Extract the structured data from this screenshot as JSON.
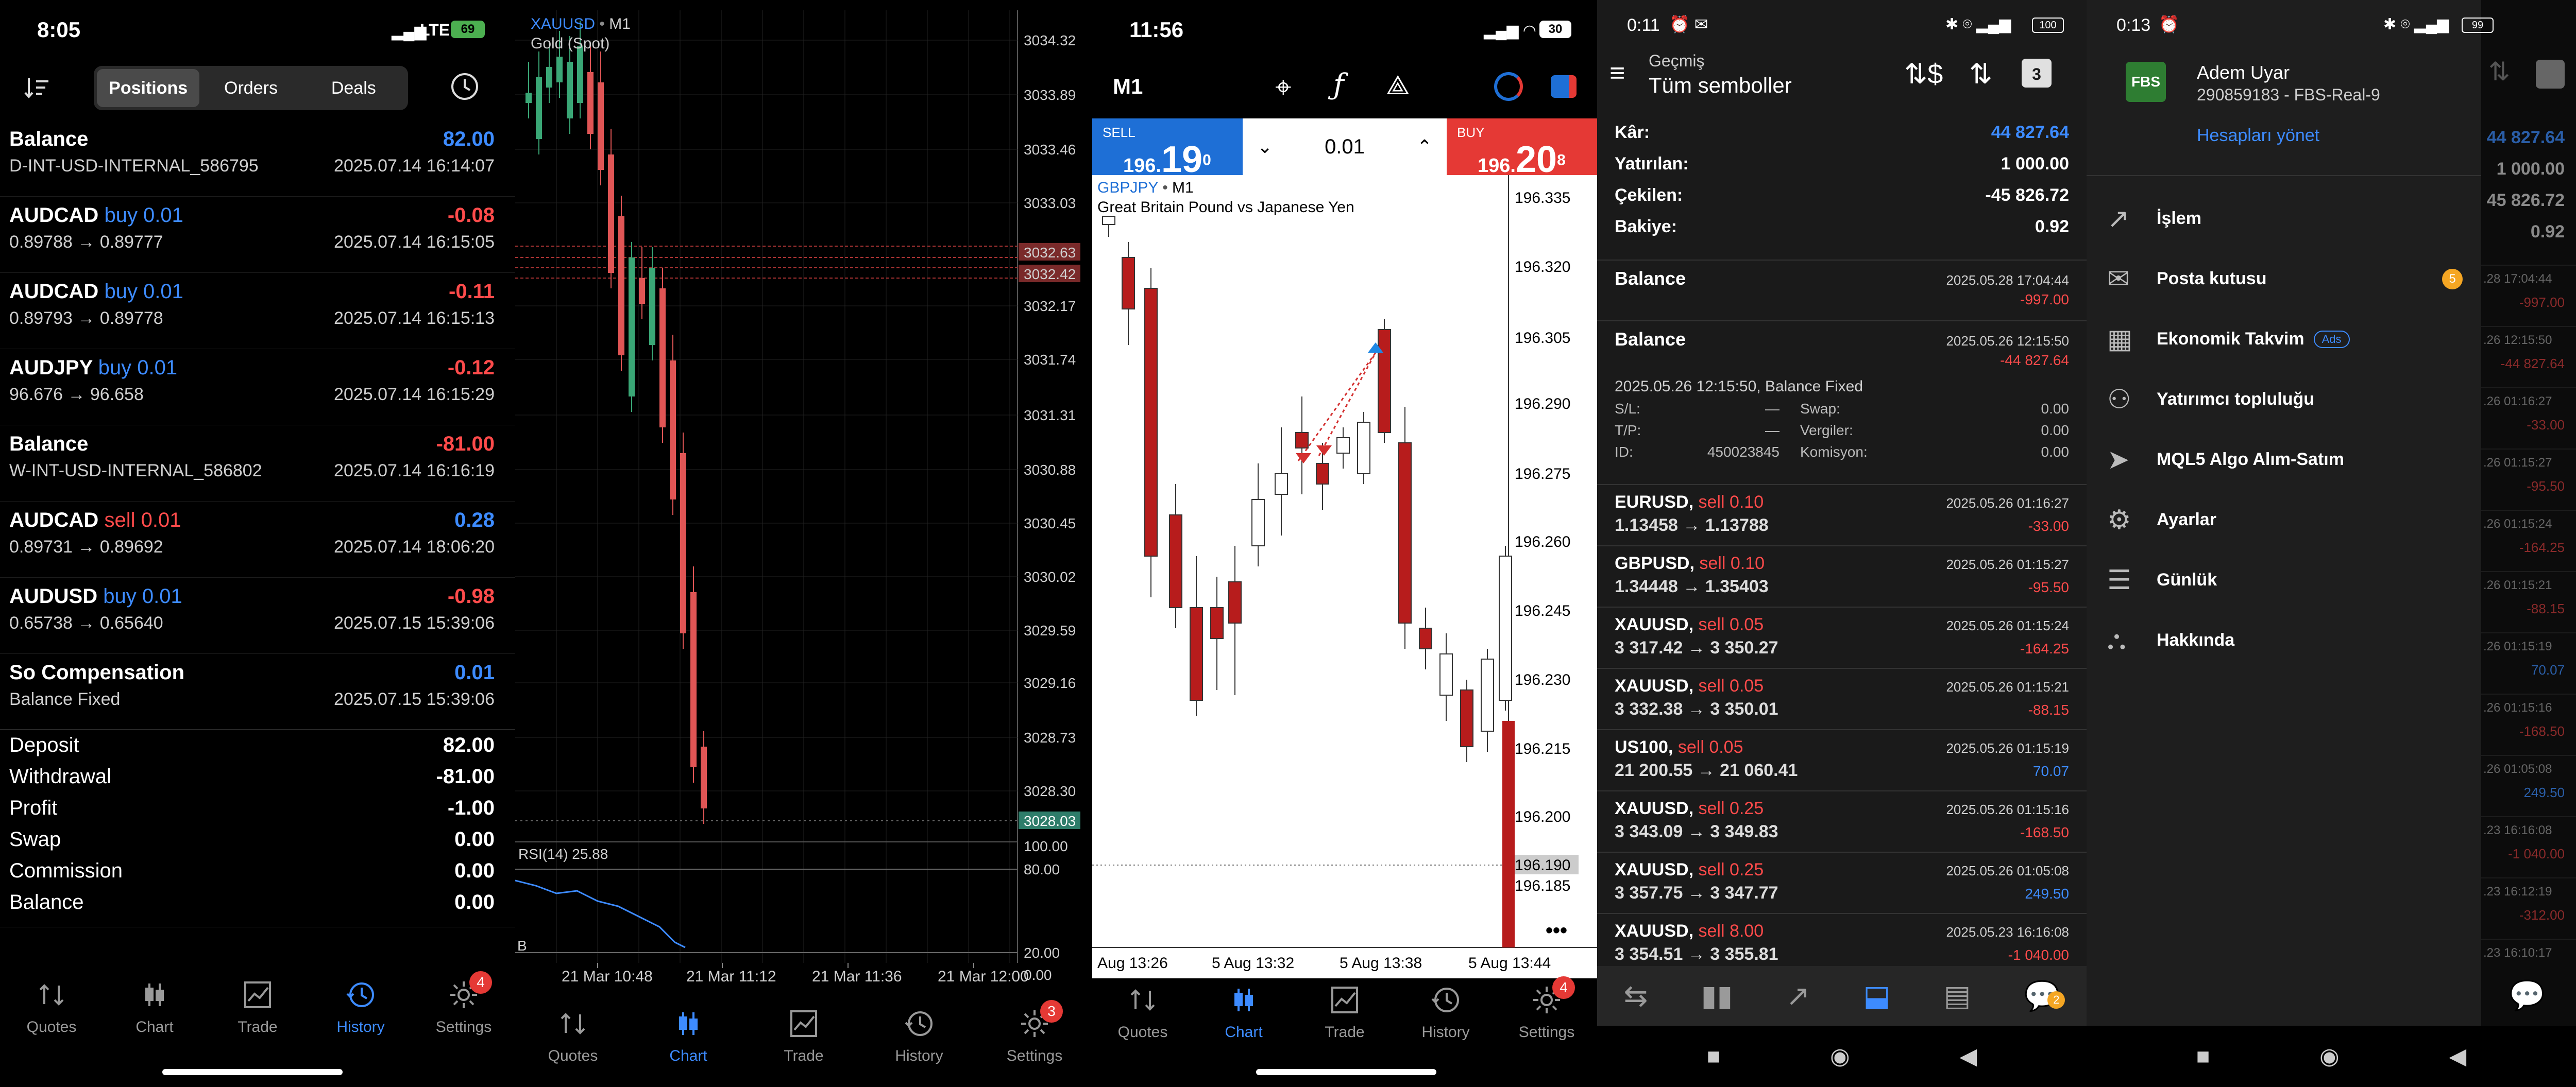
{
  "panel1": {
    "time": "8:05",
    "network": "LTE",
    "battery": "69",
    "segments": [
      "Positions",
      "Orders",
      "Deals"
    ],
    "active_segment": 0,
    "rows": [
      {
        "symbol": "Balance",
        "side": "",
        "value": "82.00",
        "value_color": "blue",
        "sub": "D-INT-USD-INTERNAL_586795",
        "time": "2025.07.14 16:14:07"
      },
      {
        "symbol": "AUDCAD",
        "side": "buy 0.01",
        "side_color": "blue",
        "value": "-0.08",
        "value_color": "red",
        "sub": "0.89788 → 0.89777",
        "time": "2025.07.14 16:15:05"
      },
      {
        "symbol": "AUDCAD",
        "side": "buy 0.01",
        "side_color": "blue",
        "value": "-0.11",
        "value_color": "red",
        "sub": "0.89793 → 0.89778",
        "time": "2025.07.14 16:15:13"
      },
      {
        "symbol": "AUDJPY",
        "side": "buy 0.01",
        "side_color": "blue",
        "value": "-0.12",
        "value_color": "red",
        "sub": "96.676 → 96.658",
        "time": "2025.07.14 16:15:29"
      },
      {
        "symbol": "Balance",
        "side": "",
        "value": "-81.00",
        "value_color": "red",
        "sub": "W-INT-USD-INTERNAL_586802",
        "time": "2025.07.14 16:16:19"
      },
      {
        "symbol": "AUDCAD",
        "side": "sell 0.01",
        "side_color": "red",
        "value": "0.28",
        "value_color": "blue",
        "sub": "0.89731 → 0.89692",
        "time": "2025.07.14 18:06:20"
      },
      {
        "symbol": "AUDUSD",
        "side": "buy 0.01",
        "side_color": "blue",
        "value": "-0.98",
        "value_color": "red",
        "sub": "0.65738 → 0.65640",
        "time": "2025.07.15 15:39:06"
      },
      {
        "symbol": "So Compensation",
        "side": "",
        "value": "0.01",
        "value_color": "blue",
        "sub": "Balance Fixed",
        "time": "2025.07.15 15:39:06"
      }
    ],
    "summary": [
      {
        "label": "Deposit",
        "value": "82.00"
      },
      {
        "label": "Withdrawal",
        "value": "-81.00"
      },
      {
        "label": "Profit",
        "value": "-1.00"
      },
      {
        "label": "Swap",
        "value": "0.00"
      },
      {
        "label": "Commission",
        "value": "0.00"
      },
      {
        "label": "Balance",
        "value": "0.00"
      }
    ],
    "tabs": [
      "Quotes",
      "Chart",
      "Trade",
      "History",
      "Settings"
    ],
    "active_tab": 3,
    "settings_badge": "4"
  },
  "panel2": {
    "symbol": "XAUUSD",
    "timeframe": "M1",
    "subtitle": "Gold (Spot)",
    "price_labels": [
      "3034.32",
      "3033.89",
      "3033.46",
      "3033.03",
      "3032.63",
      "3032.42",
      "3032.17",
      "3031.74",
      "3031.31",
      "3030.88",
      "3030.45",
      "3030.02",
      "3029.59",
      "3029.16",
      "3028.73",
      "3028.30",
      "3028.03"
    ],
    "rsi_label": "RSI(14) 25.88",
    "rsi_levels": [
      "100.00",
      "80.00",
      "20.00",
      "0.00"
    ],
    "rsi_b": "B",
    "time_labels": [
      "21 Mar 10:48",
      "21 Mar 11:12",
      "21 Mar 11:36",
      "21 Mar 12:00"
    ],
    "tabs": [
      "Quotes",
      "Chart",
      "Trade",
      "History",
      "Settings"
    ],
    "active_tab": 1,
    "settings_badge": "3"
  },
  "panel3": {
    "time": "11:56",
    "battery": "30",
    "timeframe": "M1",
    "sell_label": "SELL",
    "sell_price_small": "196.",
    "sell_price_big": "19",
    "sell_price_sup": "0",
    "buy_label": "BUY",
    "buy_price_small": "196.",
    "buy_price_big": "20",
    "buy_price_sup": "8",
    "volume": "0.01",
    "symbol": "GBPJPY",
    "symbol_tf": "M1",
    "subtitle": "Great Britain Pound vs Japanese Yen",
    "price_labels": [
      "196.335",
      "196.320",
      "196.305",
      "196.290",
      "196.275",
      "196.260",
      "196.245",
      "196.230",
      "196.215",
      "196.200",
      "196.190",
      "196.185"
    ],
    "time_labels": [
      "Aug 13:26",
      "5 Aug 13:32",
      "5 Aug 13:38",
      "5 Aug 13:44"
    ],
    "more": "•••",
    "tabs": [
      "Quotes",
      "Chart",
      "Trade",
      "History",
      "Settings"
    ],
    "active_tab": 1,
    "settings_badge": "4"
  },
  "panel4": {
    "time": "0:11",
    "battery": "100",
    "header_small": "Geçmiş",
    "header_title": "Tüm semboller",
    "calendar_num": "3",
    "summary": [
      {
        "label": "Kâr:",
        "value": "44 827.64",
        "color": "blue"
      },
      {
        "label": "Yatırılan:",
        "value": "1 000.00",
        "color": ""
      },
      {
        "label": "Çekilen:",
        "value": "-45 826.72",
        "color": ""
      },
      {
        "label": "Bakiye:",
        "value": "0.92",
        "color": ""
      }
    ],
    "balance1": {
      "title": "Balance",
      "time": "2025.05.28 17:04:44",
      "value": "-997.00"
    },
    "balance2": {
      "title": "Balance",
      "time": "2025.05.26 12:15:50",
      "value": "-44 827.64",
      "detail_title": "2025.05.26 12:15:50, Balance Fixed",
      "details": [
        {
          "k1": "S/L:",
          "v1": "—",
          "k2": "Swap:",
          "v2": "0.00"
        },
        {
          "k1": "T/P:",
          "v1": "—",
          "k2": "Vergiler:",
          "v2": "0.00"
        },
        {
          "k1": "ID:",
          "v1": "450023845",
          "k2": "Komisyon:",
          "v2": "0.00"
        }
      ]
    },
    "trades": [
      {
        "symbol": "EURUSD,",
        "side": "sell 0.10",
        "prices": "1.13458 → 1.13788",
        "time": "2025.05.26 01:16:27",
        "value": "-33.00",
        "color": "red"
      },
      {
        "symbol": "GBPUSD,",
        "side": "sell 0.10",
        "prices": "1.34448 → 1.35403",
        "time": "2025.05.26 01:15:27",
        "value": "-95.50",
        "color": "red"
      },
      {
        "symbol": "XAUUSD,",
        "side": "sell 0.05",
        "prices": "3 317.42 → 3 350.27",
        "time": "2025.05.26 01:15:24",
        "value": "-164.25",
        "color": "red"
      },
      {
        "symbol": "XAUUSD,",
        "side": "sell 0.05",
        "prices": "3 332.38 → 3 350.01",
        "time": "2025.05.26 01:15:21",
        "value": "-88.15",
        "color": "red"
      },
      {
        "symbol": "US100,",
        "side": "sell 0.05",
        "prices": "21 200.55 → 21 060.41",
        "time": "2025.05.26 01:15:19",
        "value": "70.07",
        "color": "blue"
      },
      {
        "symbol": "XAUUSD,",
        "side": "sell 0.25",
        "prices": "3 343.09 → 3 349.83",
        "time": "2025.05.26 01:15:16",
        "value": "-168.50",
        "color": "red"
      },
      {
        "symbol": "XAUUSD,",
        "side": "sell 0.25",
        "prices": "3 357.75 → 3 347.77",
        "time": "2025.05.26 01:05:08",
        "value": "249.50",
        "color": "blue"
      },
      {
        "symbol": "XAUUSD,",
        "side": "sell 8.00",
        "prices": "3 354.51 → 3 355.81",
        "time": "2025.05.23 16:16:08",
        "value": "-1 040.00",
        "color": "red"
      }
    ],
    "chat_badge": "2"
  },
  "panel5": {
    "time": "0:13",
    "battery": "99",
    "logo": "FBS",
    "user_name": "Adem Uyar",
    "account": "290859183 - FBS-Real-9",
    "manage": "Hesapları yönet",
    "menu": [
      {
        "label": "İşlem",
        "icon": "trade-icon"
      },
      {
        "label": "Posta kutusu",
        "icon": "mail-icon",
        "badge": "5"
      },
      {
        "label": "Ekonomik Takvim",
        "icon": "calendar-icon",
        "tag": "Ads"
      },
      {
        "label": "Yatırımcı topluluğu",
        "icon": "community-icon"
      },
      {
        "label": "MQL5 Algo Alım-Satım",
        "icon": "send-icon"
      },
      {
        "label": "Ayarlar",
        "icon": "gear-icon"
      },
      {
        "label": "Günlük",
        "icon": "journal-icon"
      },
      {
        "label": "Hakkında",
        "icon": "about-icon"
      }
    ],
    "bg_values": [
      {
        "text": "44 827.64",
        "color": "blue"
      },
      {
        "text": "1 000.00",
        "color": "gray"
      },
      {
        "text": "45 826.72",
        "color": "gray"
      },
      {
        "text": "0.92",
        "color": "gray"
      }
    ],
    "bg_rows": [
      {
        "time": ".28 17:04:44",
        "value": "-997.00",
        "color": "red"
      },
      {
        "time": ".26 12:15:50",
        "value": "-44 827.64",
        "color": "red"
      },
      {
        "time": ".26 01:16:27",
        "value": "-33.00",
        "color": "red"
      },
      {
        "time": ".26 01:15:27",
        "value": "-95.50",
        "color": "red"
      },
      {
        "time": ".26 01:15:24",
        "value": "-164.25",
        "color": "red"
      },
      {
        "time": ".26 01:15:21",
        "value": "-88.15",
        "color": "red"
      },
      {
        "time": ".26 01:15:19",
        "value": "70.07",
        "color": "blue"
      },
      {
        "time": ".26 01:15:16",
        "value": "-168.50",
        "color": "red"
      },
      {
        "time": ".26 01:05:08",
        "value": "249.50",
        "color": "blue"
      },
      {
        "time": ".23 16:16:08",
        "value": "-1 040.00",
        "color": "red"
      },
      {
        "time": ".23 16:12:19",
        "value": "-312.00",
        "color": "red"
      },
      {
        "time": ".23 16:10:17",
        "value": "",
        "color": "gray"
      }
    ]
  },
  "colors": {
    "blue": "#3d8bff",
    "red": "#ff4b4b",
    "sell_bg": "#1e6fd6",
    "buy_bg": "#e53935"
  }
}
